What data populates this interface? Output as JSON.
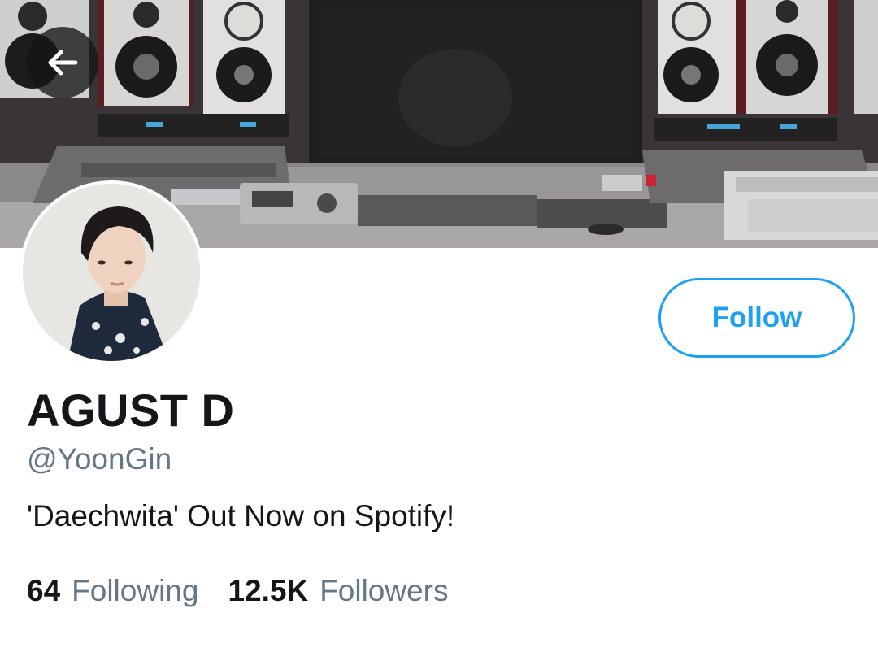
{
  "profile": {
    "display_name": "AGUST D",
    "handle": "@YoonGin",
    "bio": "'Daechwita' Out Now on Spotify!"
  },
  "actions": {
    "follow_label": "Follow"
  },
  "stats": {
    "following_count": "64",
    "following_label": "Following",
    "followers_count": "12.5K",
    "followers_label": "Followers"
  },
  "colors": {
    "accent": "#1da1f2",
    "text_primary": "#14171a",
    "text_secondary": "#657786"
  },
  "icons": {
    "back": "arrow-left-icon"
  }
}
